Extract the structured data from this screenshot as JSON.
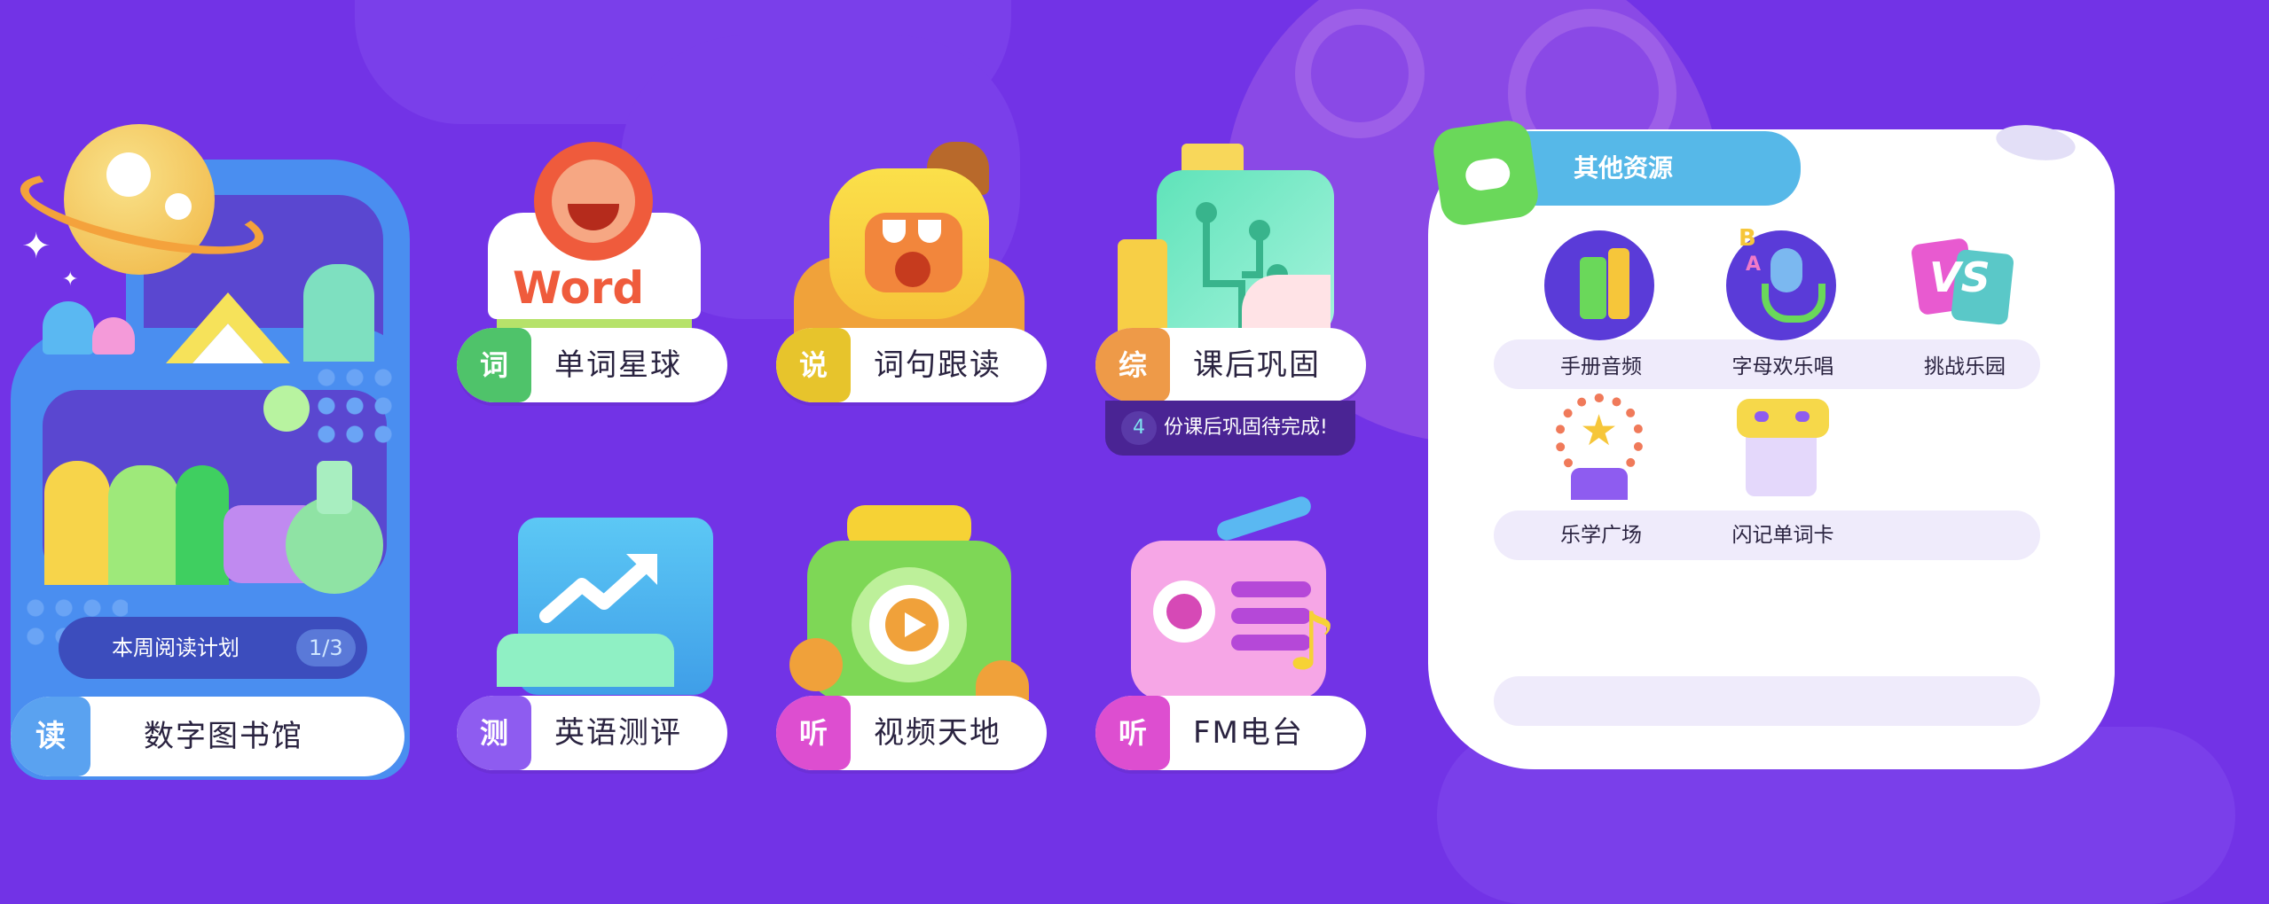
{
  "library": {
    "badge": "读",
    "label": "数字图书馆",
    "reading_plan_label": "本周阅读计划",
    "reading_plan_progress": "1/3"
  },
  "tiles": [
    {
      "badge": "词",
      "label": "单词星球",
      "badge_color": "#4fc36a"
    },
    {
      "badge": "说",
      "label": "词句跟读",
      "badge_color": "#e7c42c"
    },
    {
      "badge": "综",
      "label": "课后巩固",
      "badge_color": "#ee9a48"
    },
    {
      "badge": "测",
      "label": "英语测评",
      "badge_color": "#8e5cf0"
    },
    {
      "badge": "听",
      "label": "视频天地",
      "badge_color": "#dd4ed0"
    },
    {
      "badge": "听",
      "label": "FM电台",
      "badge_color": "#dd4ed0"
    }
  ],
  "word_sign": "Word",
  "homework_notice": {
    "count": "4",
    "text": "份课后巩固待完成!"
  },
  "other_resources": {
    "title": "其他资源",
    "items": [
      {
        "label": "手册音频",
        "icon": "book-audio-icon"
      },
      {
        "label": "字母欢乐唱",
        "icon": "microphone-abc-icon"
      },
      {
        "label": "挑战乐园",
        "icon": "vs-icon"
      },
      {
        "label": "乐学广场",
        "icon": "ferris-wheel-icon"
      },
      {
        "label": "闪记单词卡",
        "icon": "flashcard-icon"
      }
    ]
  },
  "colors": {
    "background": "#7233e6",
    "card": "#ffffff",
    "accent_blue": "#4aa3f2",
    "accent_green": "#5fd36a"
  }
}
